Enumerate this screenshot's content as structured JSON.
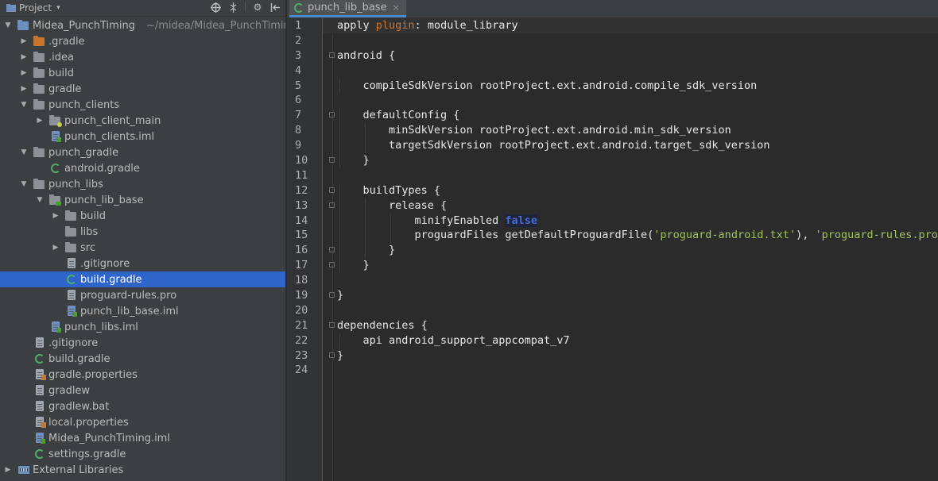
{
  "panel": {
    "title": "Project"
  },
  "tree": [
    {
      "label": "Midea_PunchTiming",
      "hint": "~/midea/Midea_PunchTiming",
      "depth": 0,
      "arrow": "down",
      "icon": "module-folder",
      "selected": false
    },
    {
      "label": ".gradle",
      "depth": 1,
      "arrow": "right",
      "icon": "folder-orange",
      "selected": false
    },
    {
      "label": ".idea",
      "depth": 1,
      "arrow": "right",
      "icon": "folder",
      "selected": false
    },
    {
      "label": "build",
      "depth": 1,
      "arrow": "right",
      "icon": "folder",
      "selected": false
    },
    {
      "label": "gradle",
      "depth": 1,
      "arrow": "right",
      "icon": "folder",
      "selected": false
    },
    {
      "label": "punch_clients",
      "depth": 1,
      "arrow": "down",
      "icon": "folder",
      "selected": false
    },
    {
      "label": "punch_client_main",
      "depth": 2,
      "arrow": "right",
      "icon": "android-module-folder",
      "selected": false
    },
    {
      "label": "punch_clients.iml",
      "depth": 2,
      "arrow": "",
      "icon": "iml-file",
      "selected": false
    },
    {
      "label": "punch_gradle",
      "depth": 1,
      "arrow": "down",
      "icon": "folder",
      "selected": false
    },
    {
      "label": "android.gradle",
      "depth": 2,
      "arrow": "",
      "icon": "gradle-file",
      "selected": false
    },
    {
      "label": "punch_libs",
      "depth": 1,
      "arrow": "down",
      "icon": "folder",
      "selected": false
    },
    {
      "label": "punch_lib_base",
      "depth": 2,
      "arrow": "down",
      "icon": "library-module-folder",
      "selected": false
    },
    {
      "label": "build",
      "depth": 3,
      "arrow": "right",
      "icon": "folder",
      "selected": false
    },
    {
      "label": "libs",
      "depth": 3,
      "arrow": "",
      "icon": "folder",
      "selected": false
    },
    {
      "label": "src",
      "depth": 3,
      "arrow": "right",
      "icon": "folder",
      "selected": false
    },
    {
      "label": ".gitignore",
      "depth": 3,
      "arrow": "",
      "icon": "text-file",
      "selected": false
    },
    {
      "label": "build.gradle",
      "depth": 3,
      "arrow": "",
      "icon": "gradle-file",
      "selected": true
    },
    {
      "label": "proguard-rules.pro",
      "depth": 3,
      "arrow": "",
      "icon": "text-file",
      "selected": false
    },
    {
      "label": "punch_lib_base.iml",
      "depth": 3,
      "arrow": "",
      "icon": "library-iml-file",
      "selected": false
    },
    {
      "label": "punch_libs.iml",
      "depth": 2,
      "arrow": "",
      "icon": "iml-file",
      "selected": false
    },
    {
      "label": ".gitignore",
      "depth": 1,
      "arrow": "",
      "icon": "text-file",
      "selected": false
    },
    {
      "label": "build.gradle",
      "depth": 1,
      "arrow": "",
      "icon": "gradle-file",
      "selected": false
    },
    {
      "label": "gradle.properties",
      "depth": 1,
      "arrow": "",
      "icon": "properties-file",
      "selected": false
    },
    {
      "label": "gradlew",
      "depth": 1,
      "arrow": "",
      "icon": "text-file",
      "selected": false
    },
    {
      "label": "gradlew.bat",
      "depth": 1,
      "arrow": "",
      "icon": "text-file",
      "selected": false
    },
    {
      "label": "local.properties",
      "depth": 1,
      "arrow": "",
      "icon": "properties-file",
      "selected": false
    },
    {
      "label": "Midea_PunchTiming.iml",
      "depth": 1,
      "arrow": "",
      "icon": "iml-file",
      "selected": false
    },
    {
      "label": "settings.gradle",
      "depth": 1,
      "arrow": "",
      "icon": "gradle-file",
      "selected": false
    },
    {
      "label": "External Libraries",
      "depth": 0,
      "arrow": "right",
      "icon": "libraries",
      "selected": false
    }
  ],
  "editor": {
    "tab_label": "punch_lib_base",
    "tab_close": "×",
    "lines": [
      {
        "n": "1",
        "indent": 0,
        "parts": [
          [
            "t",
            "apply "
          ],
          [
            "kw",
            "plugin"
          ],
          [
            "t",
            ": module_library"
          ]
        ],
        "current": true
      },
      {
        "n": "2",
        "indent": 0,
        "parts": []
      },
      {
        "n": "3",
        "indent": 0,
        "parts": [
          [
            "t",
            "android {"
          ]
        ],
        "fold": true
      },
      {
        "n": "4",
        "indent": 0,
        "parts": []
      },
      {
        "n": "5",
        "indent": 1,
        "parts": [
          [
            "t",
            "compileSdkVersion rootProject.ext.android.compile_sdk_version"
          ]
        ]
      },
      {
        "n": "6",
        "indent": 0,
        "parts": []
      },
      {
        "n": "7",
        "indent": 1,
        "parts": [
          [
            "t",
            "defaultConfig {"
          ]
        ],
        "fold": true
      },
      {
        "n": "8",
        "indent": 2,
        "parts": [
          [
            "t",
            "minSdkVersion rootProject.ext.android.min_sdk_version"
          ]
        ]
      },
      {
        "n": "9",
        "indent": 2,
        "parts": [
          [
            "t",
            "targetSdkVersion rootProject.ext.android.target_sdk_version"
          ]
        ]
      },
      {
        "n": "10",
        "indent": 1,
        "parts": [
          [
            "t",
            "}"
          ]
        ],
        "fold": true
      },
      {
        "n": "11",
        "indent": 0,
        "parts": []
      },
      {
        "n": "12",
        "indent": 1,
        "parts": [
          [
            "t",
            "buildTypes {"
          ]
        ],
        "fold": true
      },
      {
        "n": "13",
        "indent": 2,
        "parts": [
          [
            "t",
            "release {"
          ]
        ],
        "fold": true
      },
      {
        "n": "14",
        "indent": 3,
        "parts": [
          [
            "t",
            "minifyEnabled "
          ],
          [
            "false",
            "false"
          ]
        ]
      },
      {
        "n": "15",
        "indent": 3,
        "parts": [
          [
            "t",
            "proguardFiles getDefaultProguardFile("
          ],
          [
            "s",
            "'proguard-android.txt'"
          ],
          [
            "t",
            "), "
          ],
          [
            "s",
            "'proguard-rules.pro'"
          ]
        ]
      },
      {
        "n": "16",
        "indent": 2,
        "parts": [
          [
            "t",
            "}"
          ]
        ],
        "fold": true
      },
      {
        "n": "17",
        "indent": 1,
        "parts": [
          [
            "t",
            "}"
          ]
        ],
        "fold": true
      },
      {
        "n": "18",
        "indent": 0,
        "parts": []
      },
      {
        "n": "19",
        "indent": 0,
        "parts": [
          [
            "t",
            "}"
          ]
        ],
        "fold": true
      },
      {
        "n": "20",
        "indent": 0,
        "parts": []
      },
      {
        "n": "21",
        "indent": 0,
        "parts": [
          [
            "t",
            "dependencies {"
          ]
        ],
        "fold": true
      },
      {
        "n": "22",
        "indent": 1,
        "parts": [
          [
            "t",
            "api android_support_appcompat_v7"
          ]
        ]
      },
      {
        "n": "23",
        "indent": 0,
        "parts": [
          [
            "t",
            "}"
          ]
        ],
        "fold": true
      },
      {
        "n": "24",
        "indent": 0,
        "parts": []
      }
    ]
  },
  "colors": {
    "panel_bg": "#3c3f41",
    "editor_bg": "#2b2b2b",
    "selection": "#2f65ca",
    "keyword": "#cc7832",
    "string": "#a5c25c",
    "literal": "#4a6ad6"
  }
}
